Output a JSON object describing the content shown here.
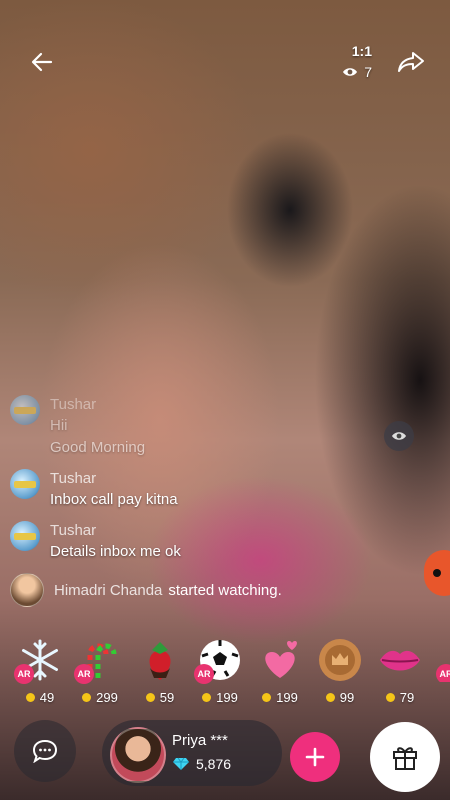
{
  "header": {
    "ratio": "1:1",
    "viewer_count": "7",
    "icons": {
      "back": "back-arrow-icon",
      "share": "share-forward-icon",
      "viewers": "eye-icon"
    }
  },
  "chat": {
    "messages": [
      {
        "name": "Tushar",
        "lines": [
          "Hii",
          "Good Morning"
        ],
        "faded": true
      },
      {
        "name": "Tushar",
        "lines": [
          "Inbox call pay kitna"
        ]
      },
      {
        "name": "Tushar",
        "lines": [
          "Details inbox me ok"
        ]
      }
    ],
    "join_event": {
      "name": "Himadri Chanda",
      "text": "started watching."
    }
  },
  "gifts": [
    {
      "icon": "snowflake-icon",
      "price": "49",
      "ar": true
    },
    {
      "icon": "candy-cane-icon",
      "price": "299",
      "ar": true
    },
    {
      "icon": "strawberry-icon",
      "price": "59",
      "ar": false
    },
    {
      "icon": "soccer-ball-icon",
      "price": "199",
      "ar": true
    },
    {
      "icon": "hearts-icon",
      "price": "199",
      "ar": false
    },
    {
      "icon": "crown-medal-icon",
      "price": "99",
      "ar": false
    },
    {
      "icon": "lips-icon",
      "price": "79",
      "ar": false
    }
  ],
  "ar_badge": "AR",
  "host": {
    "name": "Priya ***",
    "diamonds": "5,876"
  },
  "colors": {
    "accent_pink": "#ef2f7d",
    "coin_gold": "#f5c518",
    "ar_badge": "#e8336f"
  }
}
